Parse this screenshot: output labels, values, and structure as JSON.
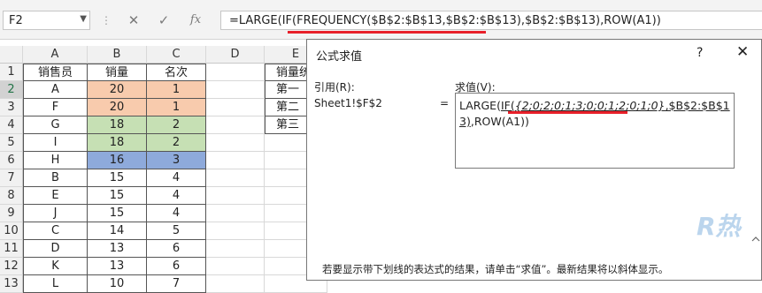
{
  "formula_bar": {
    "name_box": "F2",
    "cancel_icon": "✕",
    "enter_icon": "✓",
    "fx_label": "fx",
    "formula_prefix": "=LARGE(IF(",
    "formula_highlight": "FREQUENCY($B$2:$B$13,$B$2:$B$13)",
    "formula_suffix": ",$B$2:$B$13),ROW(A1))"
  },
  "columns": [
    "A",
    "B",
    "C",
    "D",
    "E"
  ],
  "rows": [
    "1",
    "2",
    "3",
    "4",
    "5",
    "6",
    "7",
    "8",
    "9",
    "10",
    "11",
    "12",
    "13"
  ],
  "table": {
    "headers": [
      "销售员",
      "销量",
      "名次"
    ],
    "data": [
      [
        "A",
        "20",
        "1"
      ],
      [
        "F",
        "20",
        "1"
      ],
      [
        "G",
        "18",
        "2"
      ],
      [
        "I",
        "18",
        "2"
      ],
      [
        "H",
        "16",
        "3"
      ],
      [
        "B",
        "15",
        "4"
      ],
      [
        "E",
        "15",
        "4"
      ],
      [
        "J",
        "15",
        "4"
      ],
      [
        "C",
        "14",
        "5"
      ],
      [
        "D",
        "13",
        "6"
      ],
      [
        "K",
        "13",
        "6"
      ],
      [
        "L",
        "10",
        "7"
      ]
    ]
  },
  "colors": {
    "rank1": "#f8cbad",
    "rank2": "#c6e0b4",
    "rank3": "#8eaadb",
    "accent_red": "#e8202a",
    "excel_green": "#217346"
  },
  "side_table": {
    "header": "销量统",
    "items": [
      "第一",
      "第二",
      "第三"
    ]
  },
  "dialog": {
    "title": "公式求值",
    "help": "?",
    "close": "✕",
    "reference_label": "引用(R):",
    "evaluation_label": "求值(V):",
    "reference_value": "Sheet1!$F$2",
    "equals": "=",
    "eval_prefix": "LARGE(",
    "eval_underlined": "IF(",
    "eval_italic": "{2;0;2;0;1;3;0;0;1;2;0;1;0}",
    "eval_underlined_tail": ",$B$2:$B$13)",
    "eval_suffix": ",ROW(A1))",
    "note": "若要显示带下划线的表达式的结果，请单击“求值”。最新结果将以斜体显示。"
  },
  "watermark": "R热搜下载"
}
